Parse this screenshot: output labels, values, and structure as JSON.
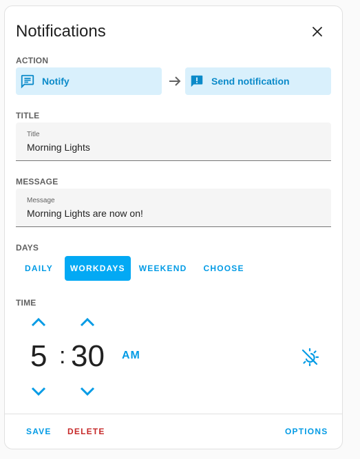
{
  "dialog": {
    "title": "Notifications"
  },
  "action": {
    "label": "ACTION",
    "service": "Notify",
    "target": "Send notification"
  },
  "title_field": {
    "section_label": "TITLE",
    "floating_label": "Title",
    "value": "Morning Lights"
  },
  "message_field": {
    "section_label": "MESSAGE",
    "floating_label": "Message",
    "value": "Morning Lights are now on!"
  },
  "days": {
    "label": "DAYS",
    "options": [
      "DAILY",
      "WORKDAYS",
      "WEEKEND",
      "CHOOSE"
    ],
    "selected": "WORKDAYS"
  },
  "time": {
    "label": "TIME",
    "hour": "5",
    "separator": ":",
    "minute": "30",
    "period": "AM"
  },
  "footer": {
    "save": "SAVE",
    "delete": "DELETE",
    "options": "OPTIONS"
  },
  "colors": {
    "accent": "#03a9f4",
    "accent_text": "#039be5",
    "action_bg": "#d9f0fc",
    "danger": "#c62828"
  }
}
